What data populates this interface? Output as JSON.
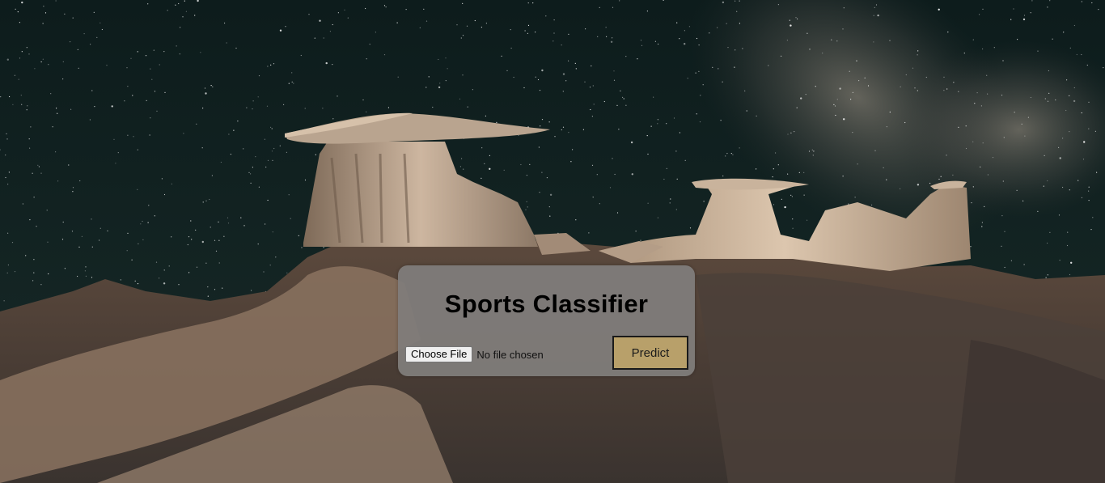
{
  "page": {
    "title": "Sports Classifier"
  },
  "background": {
    "icon": "night-sky-badlands-photo",
    "sky_color": "#0f1d1c",
    "rock_color": "#8a7563"
  },
  "upload": {
    "button_label": "Choose File",
    "status_text": "No file chosen"
  },
  "predict": {
    "label": "Predict",
    "color": "#b8a06a"
  }
}
